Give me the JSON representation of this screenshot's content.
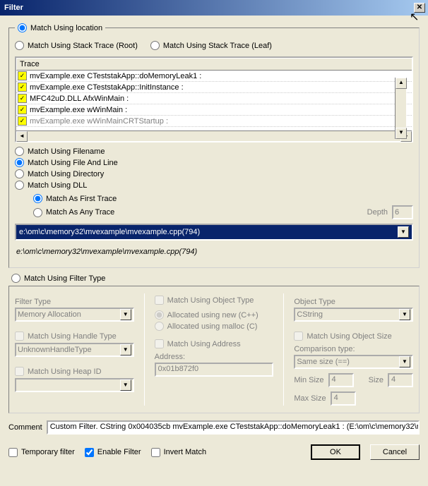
{
  "window": {
    "title": "Filter"
  },
  "top": {
    "match_location": "Match Using location",
    "match_stack_root": "Match Using Stack Trace (Root)",
    "match_stack_leaf": "Match Using Stack Trace (Leaf)"
  },
  "trace": {
    "header": "Trace",
    "rows": [
      "mvExample.exe CTeststakApp::doMemoryLeak1 :",
      "mvExample.exe CTeststakApp::InitInstance :",
      "MFC42uD.DLL AfxWinMain :",
      "mvExample.exe wWinMain :",
      "mvExample.exe wWinMainCRTStartup :"
    ]
  },
  "match_by": {
    "filename": "Match Using Filename",
    "file_line": "Match Using File And Line",
    "directory": "Match Using Directory",
    "dll": "Match Using DLL"
  },
  "trace_pos": {
    "first": "Match As First Trace",
    "any": "Match As Any Trace",
    "depth_label": "Depth",
    "depth_value": "6"
  },
  "path": {
    "dropdown": "e:\\om\\c\\memory32\\mvexample\\mvexample.cpp(794)",
    "readout": "e:\\om\\c\\memory32\\mvexample\\mvexample.cpp(794)"
  },
  "filter_type_radio": "Match Using Filter Type",
  "col1": {
    "filter_type_label": "Filter Type",
    "filter_type_value": "Memory Allocation",
    "match_handle": "Match Using Handle Type",
    "handle_value": "UnknownHandleType",
    "match_heap": "Match Using Heap ID"
  },
  "col2": {
    "match_object_type": "Match Using Object Type",
    "alloc_new": "Allocated using new (C++)",
    "alloc_malloc": "Allocated using malloc (C)",
    "match_address": "Match Using Address",
    "address_label": "Address:",
    "address_value": "0x01b872f0"
  },
  "col3": {
    "object_type_label": "Object Type",
    "object_type_value": "CString",
    "match_size": "Match Using Object Size",
    "comparison_label": "Comparison type:",
    "comparison_value": "Same size (==)",
    "min_size_label": "Min Size",
    "min_size_value": "4",
    "size_label": "Size",
    "size_value": "4",
    "max_size_label": "Max Size",
    "max_size_value": "4"
  },
  "comment": {
    "label": "Comment",
    "value": "Custom Filter. CString 0x004035cb mvExample.exe CTeststakApp::doMemoryLeak1 : (E:\\om\\c\\memory32\\m"
  },
  "bottom": {
    "temporary": "Temporary filter",
    "enable": "Enable Filter",
    "invert": "Invert Match",
    "ok": "OK",
    "cancel": "Cancel"
  }
}
